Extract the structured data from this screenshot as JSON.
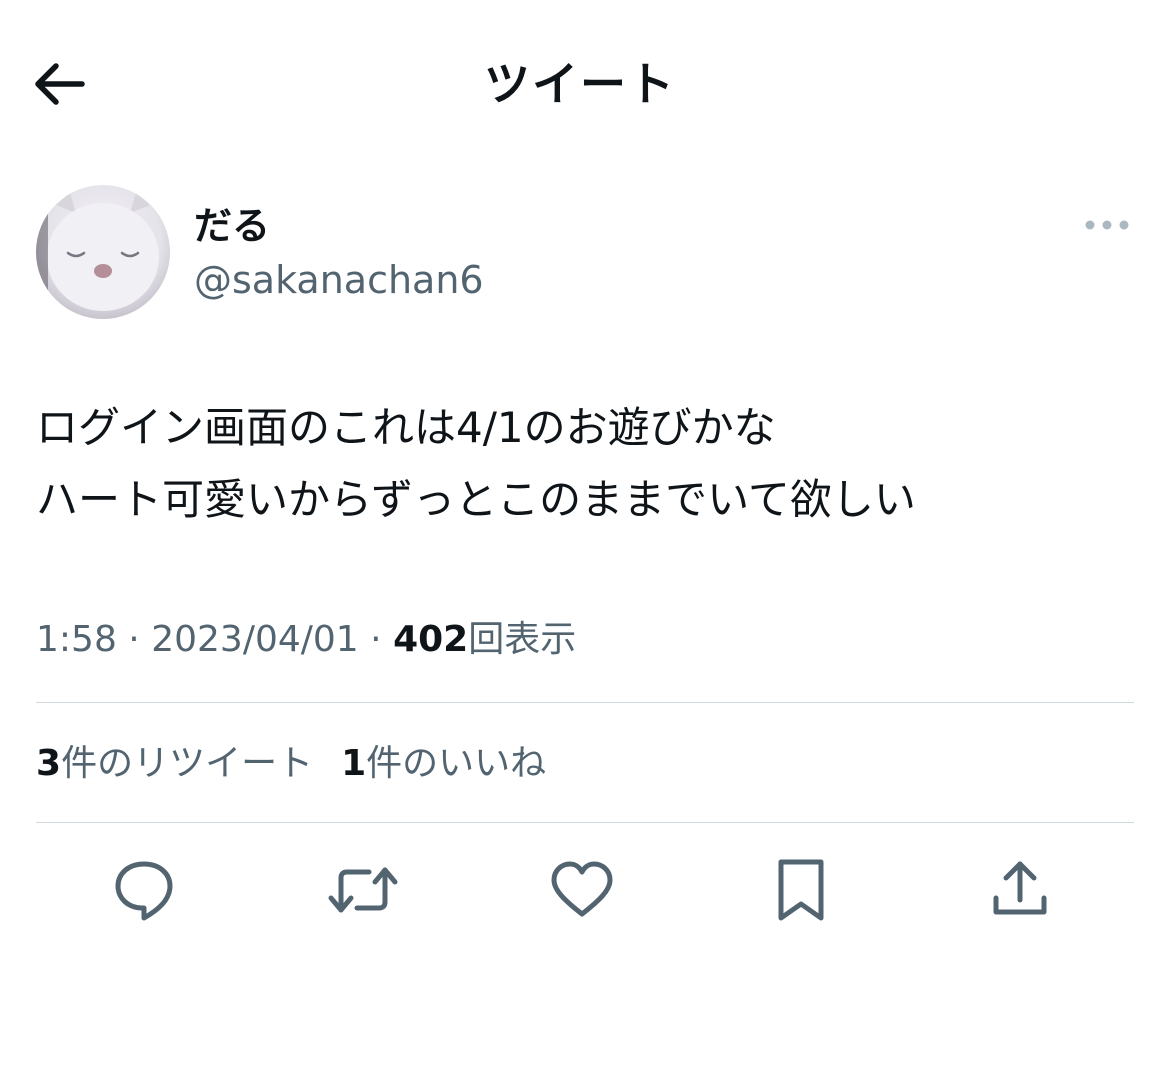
{
  "header": {
    "title": "ツイート",
    "back_icon": "arrow-left-icon"
  },
  "author": {
    "display_name": "だる",
    "handle": "@sakanachan6",
    "avatar_icon": "moogle-avatar"
  },
  "tweet": {
    "lines": [
      "ログイン画面のこれは4/1のお遊びかな",
      "ハート可愛いからずっとこのままでいて欲しい"
    ]
  },
  "meta": {
    "time": "1:58",
    "separator": "·",
    "date": "2023/04/01",
    "views_count": "402",
    "views_label": "回表示"
  },
  "stats": {
    "retweets_count": "3",
    "retweets_label": "件のリツイート",
    "likes_count": "1",
    "likes_label": "件のいいね"
  },
  "actions": [
    {
      "icon": "reply-icon"
    },
    {
      "icon": "retweet-icon"
    },
    {
      "icon": "heart-icon"
    },
    {
      "icon": "bookmark-icon"
    },
    {
      "icon": "share-icon"
    }
  ],
  "colors": {
    "text_primary": "#0f1419",
    "text_secondary": "#536471",
    "divider": "#cfd9de",
    "more_dots": "#aab8c2"
  }
}
